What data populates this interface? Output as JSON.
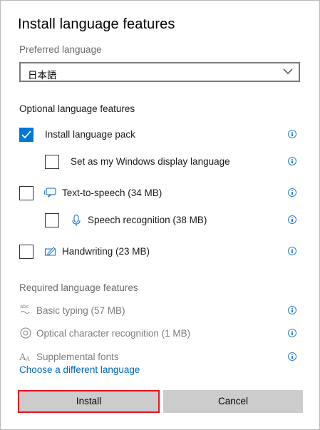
{
  "dialog": {
    "title": "Install language features",
    "preferred_language_label": "Preferred language",
    "preferred_language_value": "日本語",
    "optional_section_title": "Optional language features",
    "optional_features": [
      {
        "label": "Install language pack",
        "checked": true,
        "icon": null
      },
      {
        "label": "Set as my Windows display language",
        "checked": false,
        "icon": null
      },
      {
        "label": "Text-to-speech (34 MB)",
        "checked": false,
        "icon": "speech-bubble-icon"
      },
      {
        "label": "Speech recognition (38 MB)",
        "checked": false,
        "icon": "microphone-icon"
      },
      {
        "label": "Handwriting (23 MB)",
        "checked": false,
        "icon": "pen-icon"
      }
    ],
    "required_section_title": "Required language features",
    "required_features": [
      {
        "label": "Basic typing (57 MB)",
        "icon": "abc-typing-icon"
      },
      {
        "label": "Optical character recognition (1 MB)",
        "icon": "ocr-eye-icon"
      },
      {
        "label": "Supplemental fonts",
        "icon": "font-icon"
      }
    ],
    "choose_link": "Choose a different language",
    "install_button": "Install",
    "cancel_button": "Cancel"
  },
  "colors": {
    "accent": "#0078d7",
    "link": "#0067b8",
    "focus_border": "#e81123",
    "button_bg": "#cccccc"
  }
}
